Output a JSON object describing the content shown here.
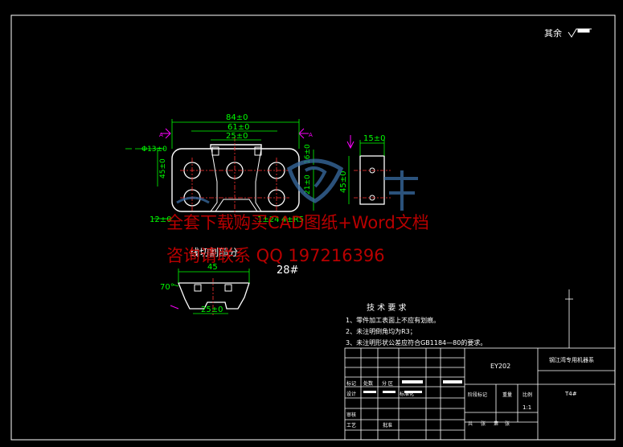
{
  "roughness_note": "其余",
  "dims": {
    "overall_width": "84±0",
    "inner_width": "61±0",
    "center_width": "25±0",
    "hole_dia": "Φ13±0",
    "left_height": "45±0",
    "right_height": "21±0",
    "right_height2": "16±0",
    "radius": "4±R5",
    "bottom_left": "12±0",
    "bottom_mid": "1±24",
    "side_width": "15±0",
    "side_height": "45±0",
    "section_top": "45",
    "section_angle": "70°",
    "section_bottom": "25±0"
  },
  "section_label": "线切割部分",
  "part_number": "28#",
  "watermark": {
    "line1": "全套下载购买CAD图纸+Word文档",
    "line2": "咨询请联系  QQ 197216396"
  },
  "tech_requirements": {
    "title": "技 术 要 求",
    "items": [
      "1、零件加工表面上不应有划痕。",
      "2、未注明倒角均为R3；",
      "3、未注明形状公差应符合GB1184—80的要求。"
    ]
  },
  "title_block": {
    "drawing_code": "EY202",
    "company": "钢江湾专用机器系",
    "material": "T4#",
    "scale": "1:1",
    "row_labels": [
      "标记",
      "处数",
      "分 区",
      "设计",
      "标准化",
      "审核",
      "工艺",
      "批准"
    ],
    "col_labels": [
      "阶段标记",
      "重量",
      "比例"
    ],
    "bottom_labels": [
      "共",
      "张",
      "第",
      "张"
    ]
  },
  "colors": {
    "outline": "#ffffff",
    "dimension": "#00ff00",
    "center": "#ff3030",
    "mark": "#ff00ff",
    "watermark": "#cc0000",
    "logo": "#3a6ea5"
  }
}
